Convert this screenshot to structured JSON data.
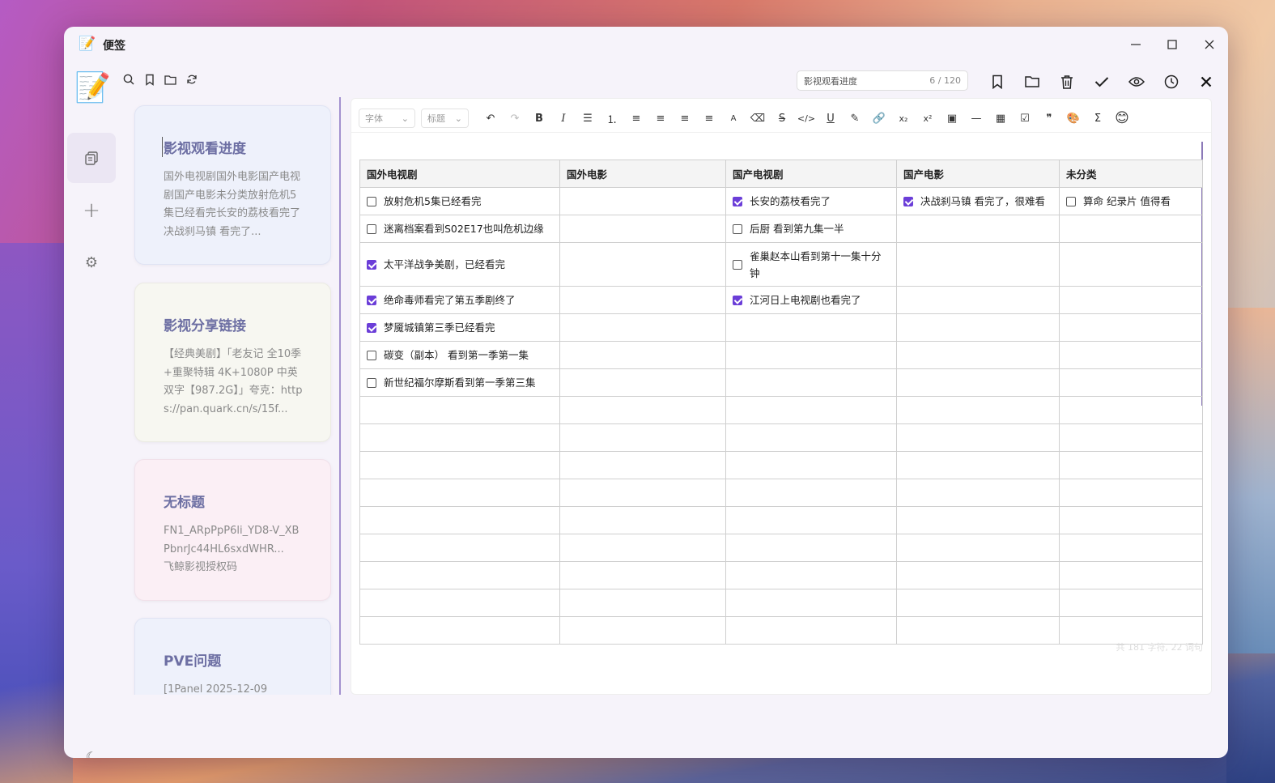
{
  "window": {
    "app_title": "便签"
  },
  "rail": {
    "logo": "📝",
    "notes_icon": "notes-icon",
    "add": "+",
    "settings": "⚙",
    "theme": "☾"
  },
  "list_toolbar": {
    "search": "○",
    "bookmark": "⌖",
    "folder": "▭",
    "refresh": "↻"
  },
  "notes": [
    {
      "title": "影视观看进度",
      "preview": "国外电视剧国外电影国产电视剧国产电影未分类放射危机5集已经看完长安的荔枝看完了决战刹马镇 看完了..."
    },
    {
      "title": "影视分享链接",
      "preview": "【经典美剧】「老友记 全10季+重聚特辑 4K+1080P 中英双字【987.2G】」夸克：https://pan.quark.cn/s/15f..."
    },
    {
      "title": "无标题",
      "preview": "FN1_ARpPpP6li_YD8-V_XBPbnrJc44HL6sxdWHR...\n飞鲸影视授权码"
    },
    {
      "title": "PVE问题",
      "preview": "[1Panel 2025-12-09"
    }
  ],
  "editor": {
    "title_value": "影视观看进度",
    "title_count": "6 / 120",
    "font_select": "字体",
    "heading_select": "标题",
    "word_count": "共 181 字符, 22 词句"
  },
  "table": {
    "headers": [
      "国外电视剧",
      "国外电影",
      "国产电视剧",
      "国产电影",
      "未分类"
    ],
    "rows": [
      [
        {
          "t": "放射危机5集已经看完",
          "c": false
        },
        null,
        {
          "t": "长安的荔枝看完了",
          "c": true
        },
        {
          "t": "决战刹马镇 看完了，很难看",
          "c": true
        },
        {
          "t": "算命 纪录片 值得看",
          "c": false
        }
      ],
      [
        {
          "t": "迷离档案看到S02E17也叫危机边缘",
          "c": false
        },
        null,
        {
          "t": "后厨 看到第九集一半",
          "c": false
        },
        null,
        null
      ],
      [
        {
          "t": "太平洋战争美剧，已经看完",
          "c": true
        },
        null,
        {
          "t": "雀巢赵本山看到第十一集十分钟",
          "c": false
        },
        null,
        null
      ],
      [
        {
          "t": "绝命毒师看完了第五季剧终了",
          "c": true
        },
        null,
        {
          "t": "江河日上电视剧也看完了",
          "c": true
        },
        null,
        null
      ],
      [
        {
          "t": "梦魇城镇第三季已经看完",
          "c": true
        },
        null,
        null,
        null,
        null
      ],
      [
        {
          "t": "碳变（副本） 看到第一季第一集",
          "c": false
        },
        null,
        null,
        null,
        null
      ],
      [
        {
          "t": "新世纪福尔摩斯看到第一季第三集",
          "c": false
        },
        null,
        null,
        null,
        null
      ]
    ],
    "empty_rows": 9
  }
}
